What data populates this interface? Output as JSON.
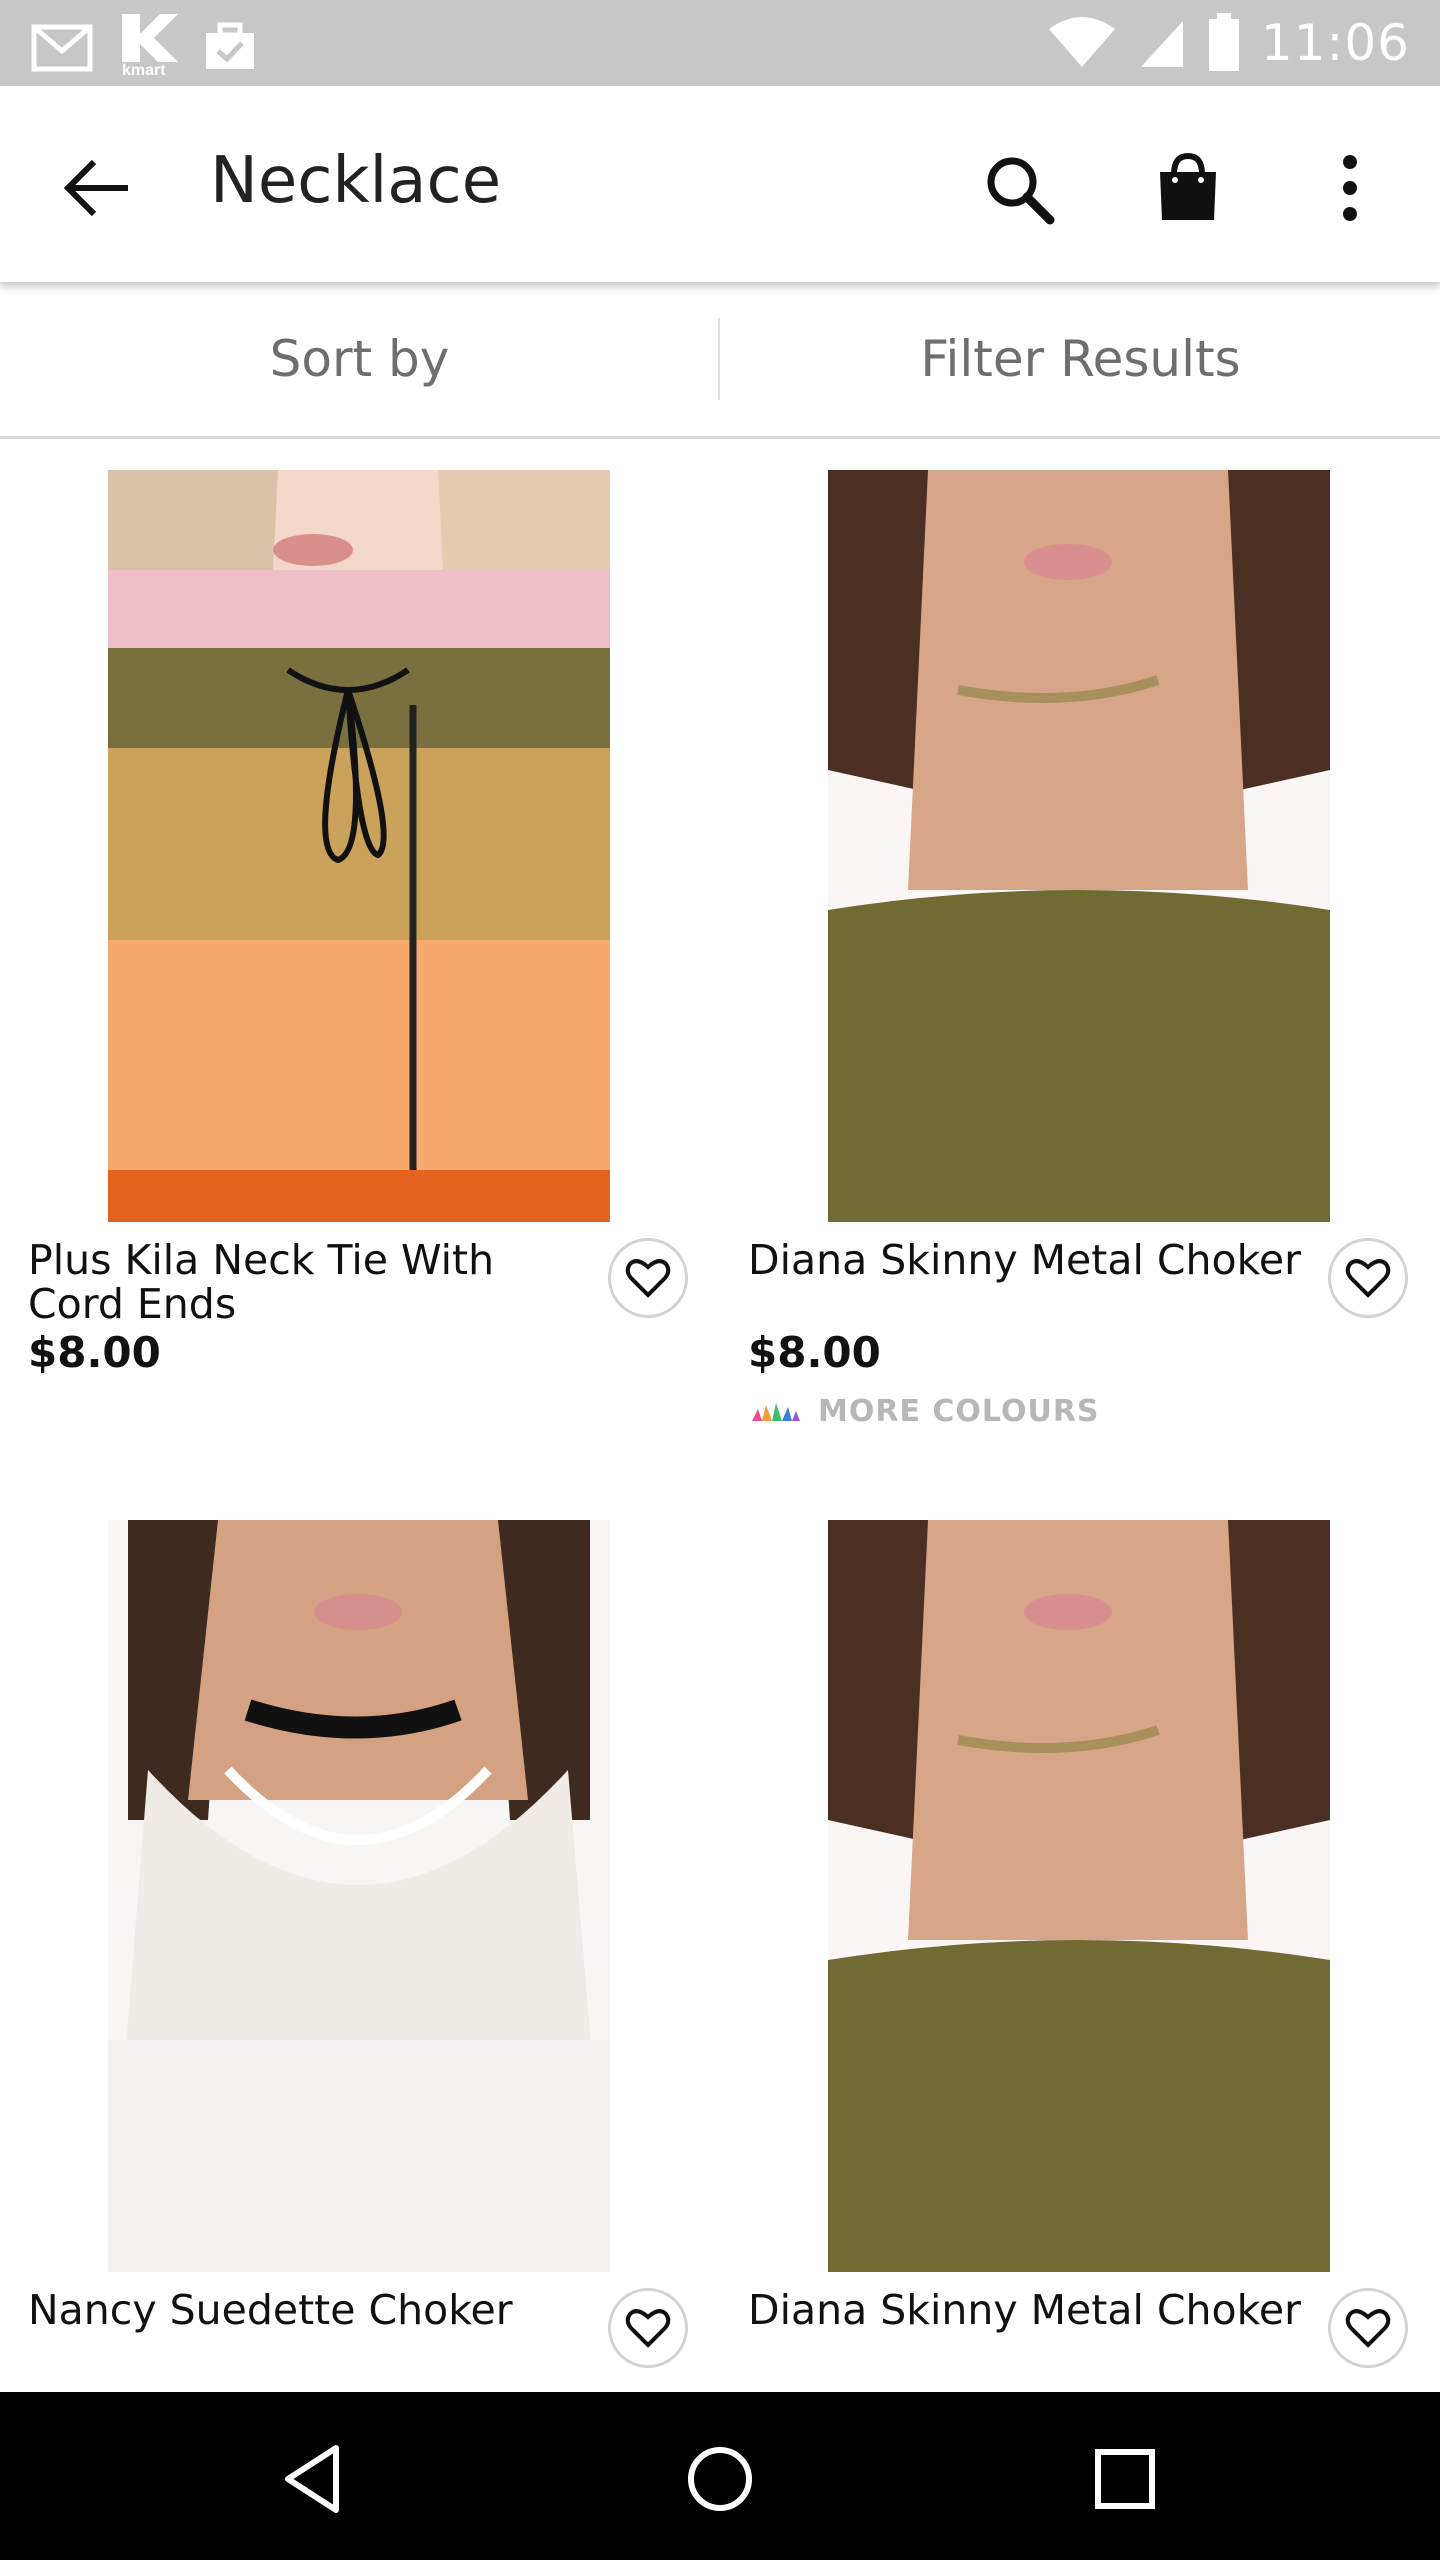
{
  "status_bar": {
    "time": "11:06",
    "notification_icons": [
      "gmail-icon",
      "kmart-icon",
      "briefcase-check-icon"
    ],
    "kmart_caption": "kmart"
  },
  "app_bar": {
    "title": "Necklace"
  },
  "sort_filter": {
    "sort_label": "Sort by",
    "filter_label": "Filter Results"
  },
  "products": [
    {
      "name": "Plus Kila Neck Tie With Cord Ends",
      "price": "$8.00",
      "more_colours": ""
    },
    {
      "name": "Diana Skinny Metal Choker",
      "price": "$8.00",
      "more_colours": "MORE COLOURS"
    },
    {
      "name": "Nancy Suedette Choker",
      "price": "",
      "more_colours": ""
    },
    {
      "name": "Diana Skinny Metal Choker",
      "price": "",
      "more_colours": ""
    }
  ],
  "colors": {
    "status_bar": "#c7c7c7",
    "nav_bar": "#000000",
    "muted_text": "#6e6e6e",
    "olive_top": "#6f6b33"
  }
}
